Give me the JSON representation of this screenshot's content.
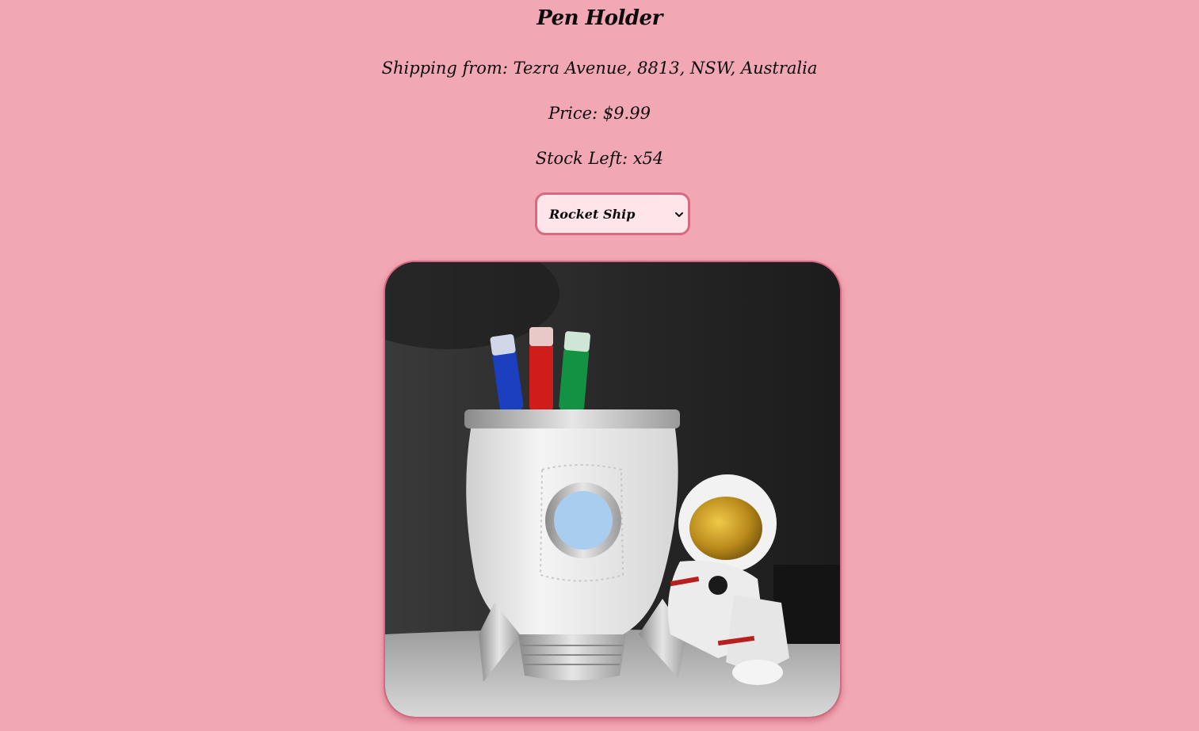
{
  "product": {
    "title": "Pen Holder",
    "shipping": "Shipping from: Tezra Avenue, 8813, NSW, Australia",
    "price": "Price: $9.99",
    "stock": "Stock Left: x54"
  },
  "variant_select": {
    "selected": "Rocket Ship",
    "icon": "chevron-down-icon"
  },
  "colors": {
    "background": "#f2a7b4",
    "accent_border": "#d56a80",
    "select_fill": "#ffe4ea"
  }
}
